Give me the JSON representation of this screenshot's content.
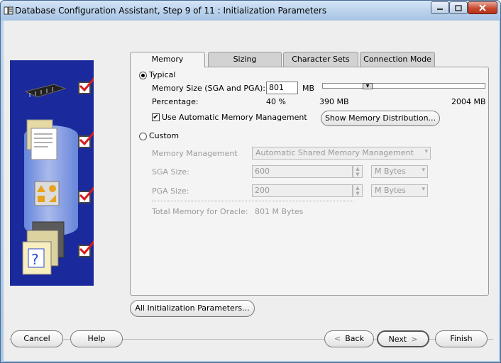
{
  "window": {
    "title": "Database Configuration Assistant, Step 9 of 11 : Initialization Parameters"
  },
  "tabs": [
    {
      "label": "Memory",
      "active": true
    },
    {
      "label": "Sizing",
      "active": false
    },
    {
      "label": "Character Sets",
      "active": false
    },
    {
      "label": "Connection Mode",
      "active": false
    }
  ],
  "memory": {
    "typical_label": "Typical",
    "memory_size_label": "Memory Size (SGA and PGA):",
    "memory_size_value": "801",
    "memory_size_unit": "MB",
    "percentage_label": "Percentage:",
    "percentage_value": "40 %",
    "slider_min_label": "390 MB",
    "slider_max_label": "2004 MB",
    "slider_fraction": 0.26,
    "amm_label": "Use Automatic Memory Management",
    "amm_checked": true,
    "show_distribution_button": "Show Memory Distribution...",
    "custom_label": "Custom",
    "memory_management_label": "Memory Management",
    "memory_management_value": "Automatic Shared Memory Management",
    "sga_label": "SGA Size:",
    "sga_value": "600",
    "sga_unit": "M Bytes",
    "pga_label": "PGA Size:",
    "pga_value": "200",
    "pga_unit": "M Bytes",
    "total_label": "Total Memory for Oracle:",
    "total_value": "801 M Bytes"
  },
  "buttons": {
    "all_params": "All Initialization Parameters...",
    "cancel": "Cancel",
    "help": "Help",
    "back": "Back",
    "next": "Next",
    "finish": "Finish"
  },
  "side_steps": [
    {
      "icon": "chip-icon",
      "done": true
    },
    {
      "icon": "documents-icon",
      "done": true
    },
    {
      "icon": "shapes-icon",
      "done": true
    },
    {
      "icon": "help-folder-icon",
      "done": true
    }
  ],
  "colors": {
    "side_panel": "#1a2a9c",
    "check_mark": "#d91a1a"
  }
}
